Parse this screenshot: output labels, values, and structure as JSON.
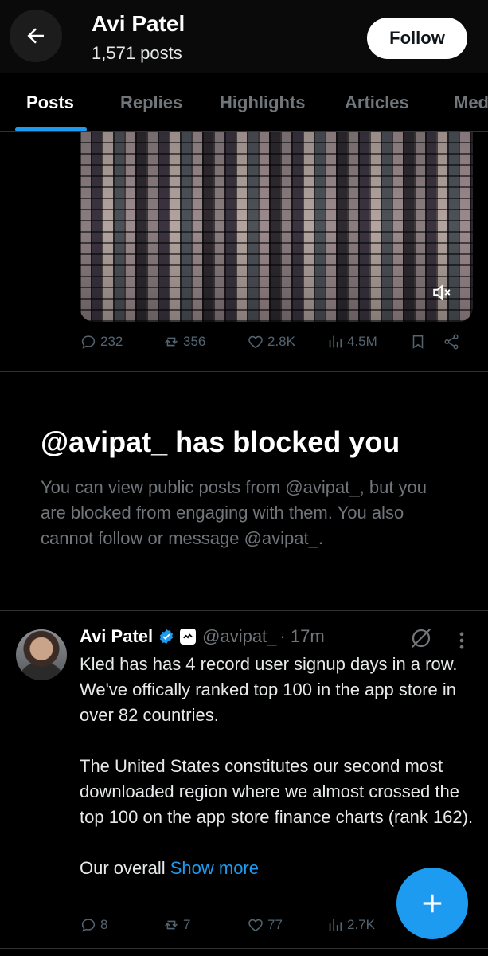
{
  "header": {
    "name": "Avi Patel",
    "posts_count": "1,571 posts",
    "follow_label": "Follow"
  },
  "tabs": [
    {
      "label": "Posts",
      "active": true
    },
    {
      "label": "Replies",
      "active": false
    },
    {
      "label": "Highlights",
      "active": false
    },
    {
      "label": "Articles",
      "active": false
    },
    {
      "label": "Media",
      "active": false
    }
  ],
  "media_post": {
    "replies": "232",
    "reposts": "356",
    "likes": "2.8K",
    "views": "4.5M"
  },
  "blocked": {
    "title": "@avipat_ has blocked you",
    "message": "You can view public posts from @avipat_, but you are blocked from engaging with them. You also cannot follow or message @avipat_."
  },
  "tweet": {
    "name": "Avi Patel",
    "handle": "@avipat_",
    "time": "· 17m",
    "paragraph1": "Kled has has 4 record user signup days in a row. We've offically ranked top 100 in the app store in over 82 countries.",
    "paragraph2": "The United States constitutes our second most downloaded region where we almost crossed the top 100 on the app store finance charts (rank 162).",
    "paragraph3_prefix": "Our overall ",
    "show_more": "Show more",
    "replies": "8",
    "reposts": "7",
    "likes": "77",
    "views": "2.7K"
  },
  "colors": {
    "accent": "#1d9bf0",
    "background": "#000000",
    "muted_text": "#71767b"
  },
  "icons": [
    "back-arrow-icon",
    "reply-icon",
    "repost-icon",
    "like-icon",
    "views-icon",
    "bookmark-icon",
    "share-icon",
    "mute-icon",
    "verified-icon",
    "grok-icon",
    "more-icon",
    "plus-icon"
  ]
}
